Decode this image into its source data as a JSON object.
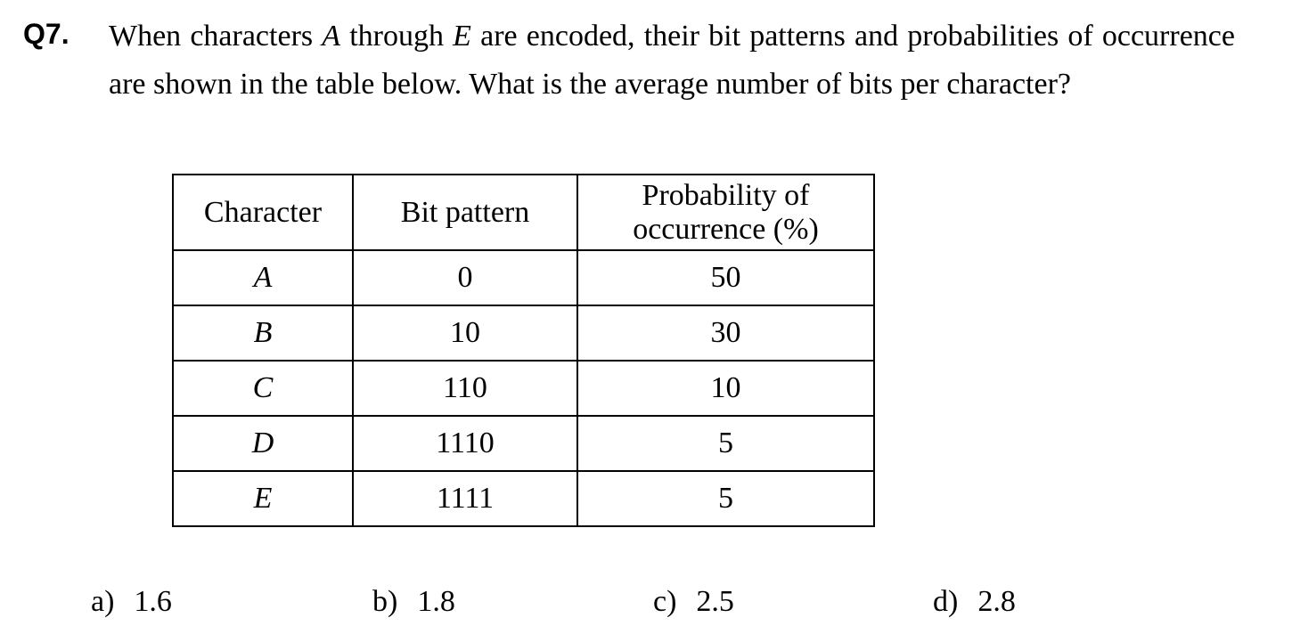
{
  "question": {
    "number": "Q7.",
    "intro": "When characters ",
    "char_start": "A",
    "through": " through ",
    "char_end": "E",
    "rest_line1": " are encoded, their bit patterns and probabilities of occurrence are shown in the table below.  What is the average number of bits per character?"
  },
  "table": {
    "headers": {
      "character": "Character",
      "bit_pattern": "Bit pattern",
      "probability": "Probability of occurrence (%)"
    },
    "rows": [
      {
        "character": "A",
        "bit_pattern": "0",
        "probability": "50"
      },
      {
        "character": "B",
        "bit_pattern": "10",
        "probability": "30"
      },
      {
        "character": "C",
        "bit_pattern": "110",
        "probability": "10"
      },
      {
        "character": "D",
        "bit_pattern": "1110",
        "probability": "5"
      },
      {
        "character": "E",
        "bit_pattern": "1111",
        "probability": "5"
      }
    ]
  },
  "options": {
    "a": {
      "letter": "a)",
      "value": "1.6"
    },
    "b": {
      "letter": "b)",
      "value": "1.8"
    },
    "c": {
      "letter": "c)",
      "value": "2.5"
    },
    "d": {
      "letter": "d)",
      "value": "2.8"
    }
  }
}
